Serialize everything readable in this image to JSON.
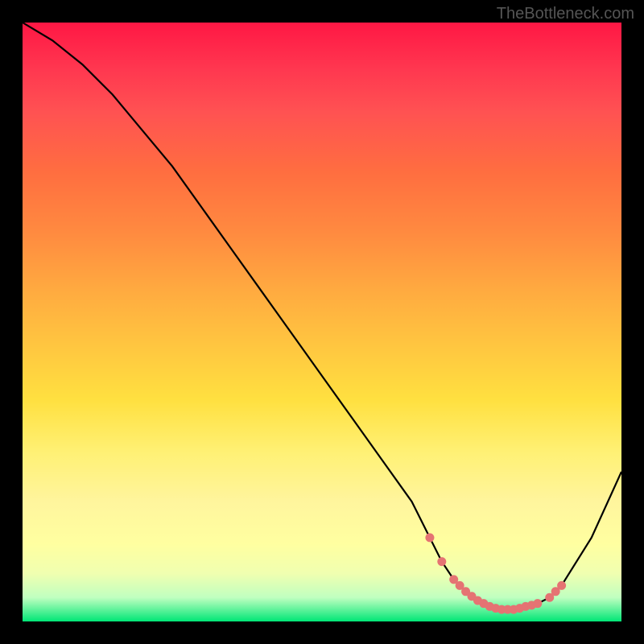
{
  "watermark": "TheBottleneck.com",
  "chart_data": {
    "type": "line",
    "title": "",
    "xlabel": "",
    "ylabel": "",
    "xlim": [
      0,
      100
    ],
    "ylim": [
      0,
      100
    ],
    "grid": false,
    "series": [
      {
        "name": "bottleneck-curve",
        "x": [
          0,
          5,
          10,
          15,
          20,
          25,
          30,
          35,
          40,
          45,
          50,
          55,
          60,
          65,
          68,
          70,
          72,
          74,
          76,
          78,
          80,
          82,
          84,
          86,
          88,
          90,
          95,
          100
        ],
        "y": [
          100,
          97,
          93,
          88,
          82,
          76,
          69,
          62,
          55,
          48,
          41,
          34,
          27,
          20,
          14,
          10,
          7,
          5,
          3.5,
          2.5,
          2,
          2,
          2.5,
          3,
          4,
          6,
          14,
          25
        ]
      }
    ],
    "marker_points": {
      "x": [
        68,
        70,
        72,
        73,
        74,
        75,
        76,
        77,
        78,
        79,
        80,
        81,
        82,
        83,
        84,
        85,
        86,
        88,
        89,
        90
      ],
      "y": [
        14,
        10,
        7,
        6,
        5,
        4.2,
        3.5,
        3,
        2.5,
        2.2,
        2,
        2,
        2,
        2.2,
        2.5,
        2.7,
        3,
        4,
        5,
        6
      ]
    },
    "colors": {
      "curve": "#000000",
      "markers": "#e57373",
      "gradient_top": "#ff1744",
      "gradient_bottom": "#00e676"
    }
  }
}
